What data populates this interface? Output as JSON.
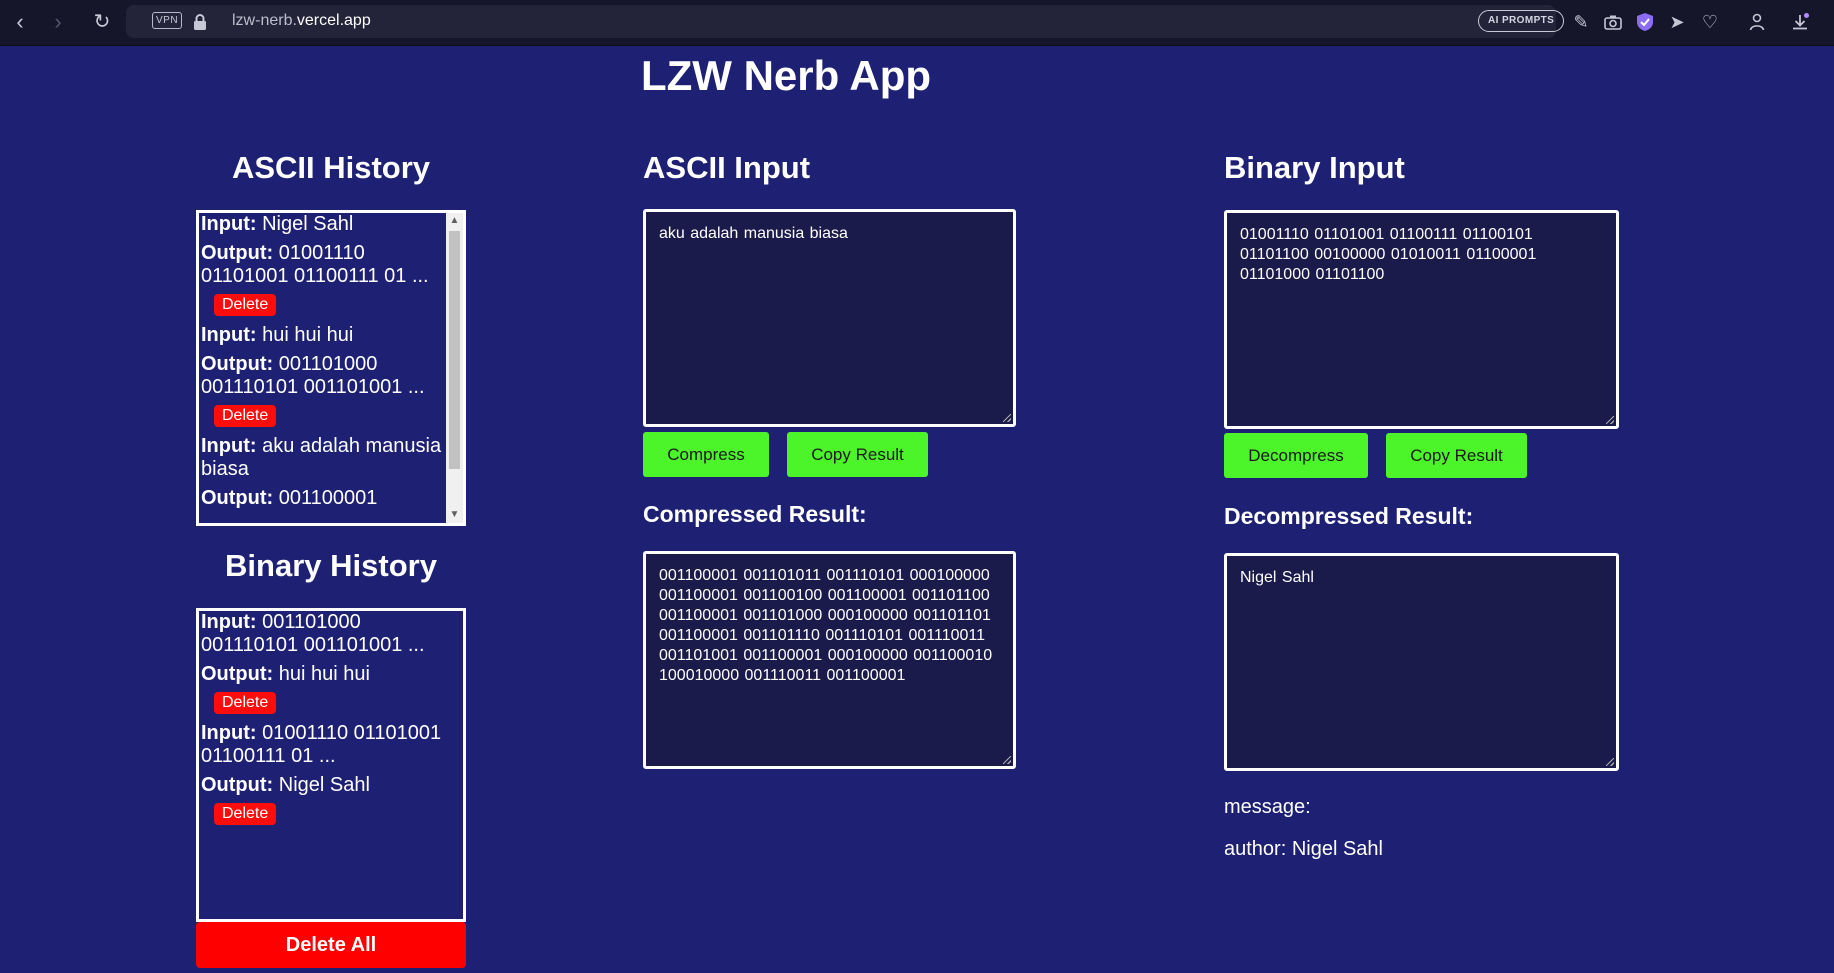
{
  "browser": {
    "vpn_label": "VPN",
    "url_host": "lzw-nerb.",
    "url_domain": "vercel.app",
    "ai_prompts_label": "AI PROMPTS"
  },
  "page": {
    "title": "LZW Nerb App"
  },
  "ascii_history": {
    "title": "ASCII History",
    "entries": [
      {
        "input_label": "Input:",
        "input": "Nigel Sahl",
        "output_label": "Output:",
        "output": "01001110 01101001 01100111 01 ...",
        "delete_label": "Delete"
      },
      {
        "input_label": "Input:",
        "input": "hui hui hui",
        "output_label": "Output:",
        "output": "001101000 001110101 001101001 ...",
        "delete_label": "Delete"
      },
      {
        "input_label": "Input:",
        "input": "aku adalah manusia biasa",
        "output_label": "Output:",
        "output": "001100001"
      }
    ]
  },
  "binary_history": {
    "title": "Binary History",
    "entries": [
      {
        "input_label": "Input:",
        "input": "001101000 001110101 001101001 ...",
        "output_label": "Output:",
        "output": "hui hui hui",
        "delete_label": "Delete"
      },
      {
        "input_label": "Input:",
        "input": "01001110 01101001 01100111 01 ...",
        "output_label": "Output:",
        "output": "Nigel Sahl",
        "delete_label": "Delete"
      }
    ],
    "delete_all_label": "Delete All"
  },
  "ascii_input": {
    "title": "ASCII Input",
    "value": "aku adalah manusia biasa",
    "compress_label": "Compress",
    "copy_label": "Copy Result",
    "result_title": "Compressed Result:",
    "result_value": "001100001 001101011 001110101 000100000 001100001 001100100 001100001 001101100 001100001 001101000 000100000 001101101 001100001 001101110 001110101 001110011 001101001 001100001 000100000 001100010 100010000 001110011 001100001"
  },
  "binary_input": {
    "title": "Binary Input",
    "value": "01001110 01101001 01100111 01100101 01101100 00100000 01010011 01100001 01101000 01101100",
    "decompress_label": "Decompress",
    "copy_label": "Copy Result",
    "result_title": "Decompressed Result:",
    "result_value": "Nigel Sahl",
    "message_text": "message:",
    "author_text": "author: Nigel Sahl"
  }
}
